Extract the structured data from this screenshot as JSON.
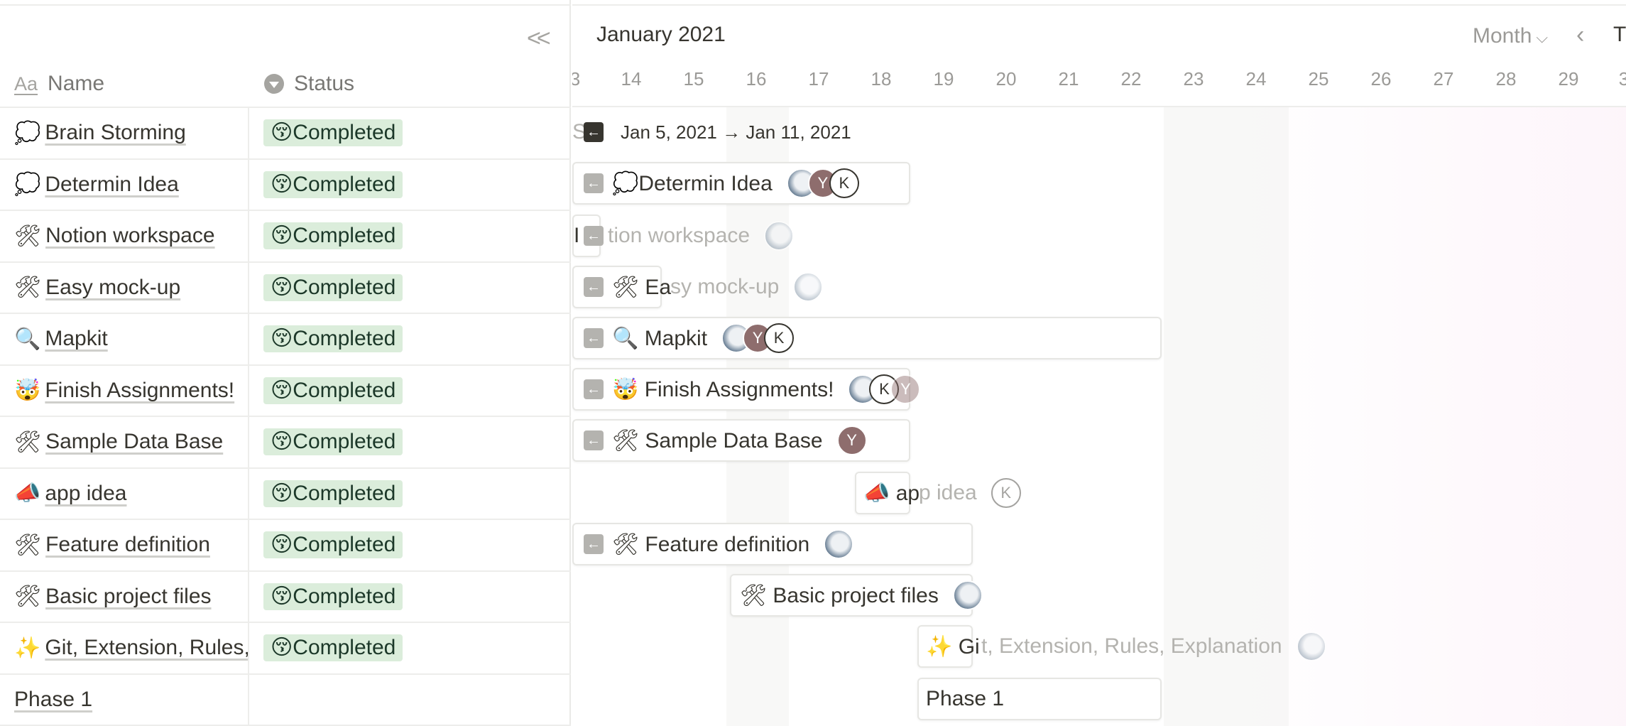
{
  "table": {
    "collapse_label": "<<",
    "columns": {
      "name": "Name",
      "status": "Status",
      "name_icon": "Aa",
      "status_icon": "status-select-icon"
    },
    "rows": [
      {
        "emoji": "💭",
        "name": "Brain Storming",
        "status": "😚Completed"
      },
      {
        "emoji": "💭",
        "name": "Determin Idea",
        "status": "😚Completed"
      },
      {
        "emoji": "🛠",
        "name": "Notion workspace",
        "status": "😚Completed"
      },
      {
        "emoji": "🛠",
        "name": "Easy mock-up",
        "status": "😚Completed"
      },
      {
        "emoji": "🔍",
        "name": "Mapkit",
        "status": "😚Completed"
      },
      {
        "emoji": "🤯",
        "name": "Finish Assignments!",
        "status": "😚Completed"
      },
      {
        "emoji": "🛠",
        "name": "Sample Data Base",
        "status": "😚Completed"
      },
      {
        "emoji": "📣",
        "name": "app idea",
        "status": "😚Completed"
      },
      {
        "emoji": "🛠",
        "name": "Feature definition",
        "status": "😚Completed"
      },
      {
        "emoji": "🛠",
        "name": "Basic project files",
        "status": "😚Completed"
      },
      {
        "emoji": "✨",
        "name": "Git, Extension, Rules, Explanation",
        "status": "😚Completed"
      },
      {
        "emoji": "",
        "name": "Phase 1",
        "status": ""
      }
    ]
  },
  "timeline": {
    "month": "January 2021",
    "view": "Month",
    "today_label": "T",
    "days": [
      "3",
      "14",
      "15",
      "16",
      "17",
      "18",
      "19",
      "20",
      "21",
      "22",
      "23",
      "24",
      "25",
      "26",
      "27",
      "28",
      "29",
      "3"
    ],
    "bars": {
      "brain": {
        "prefix": "St",
        "date_range": "Jan 5, 2021 → Jan 11, 2021"
      },
      "determin": "💭Determin Idea",
      "notion": "tion workspace",
      "notion_prefix": "I",
      "mockup_a": "🛠 Ea",
      "mockup_b": "sy mock-up",
      "mapkit": "🔍 Mapkit",
      "finish": "🤯 Finish Assignments!",
      "sample": "🛠 Sample Data Base",
      "app_a": "📣 ap",
      "app_b": "p idea",
      "feature": "🛠 Feature definition",
      "basic": "🛠 Basic project files",
      "git_a": "✨ Gi",
      "git_b": "t, Extension, Rules, Explanation",
      "phase": "Phase 1"
    },
    "avatars": {
      "y": "Y",
      "k": "K"
    }
  }
}
